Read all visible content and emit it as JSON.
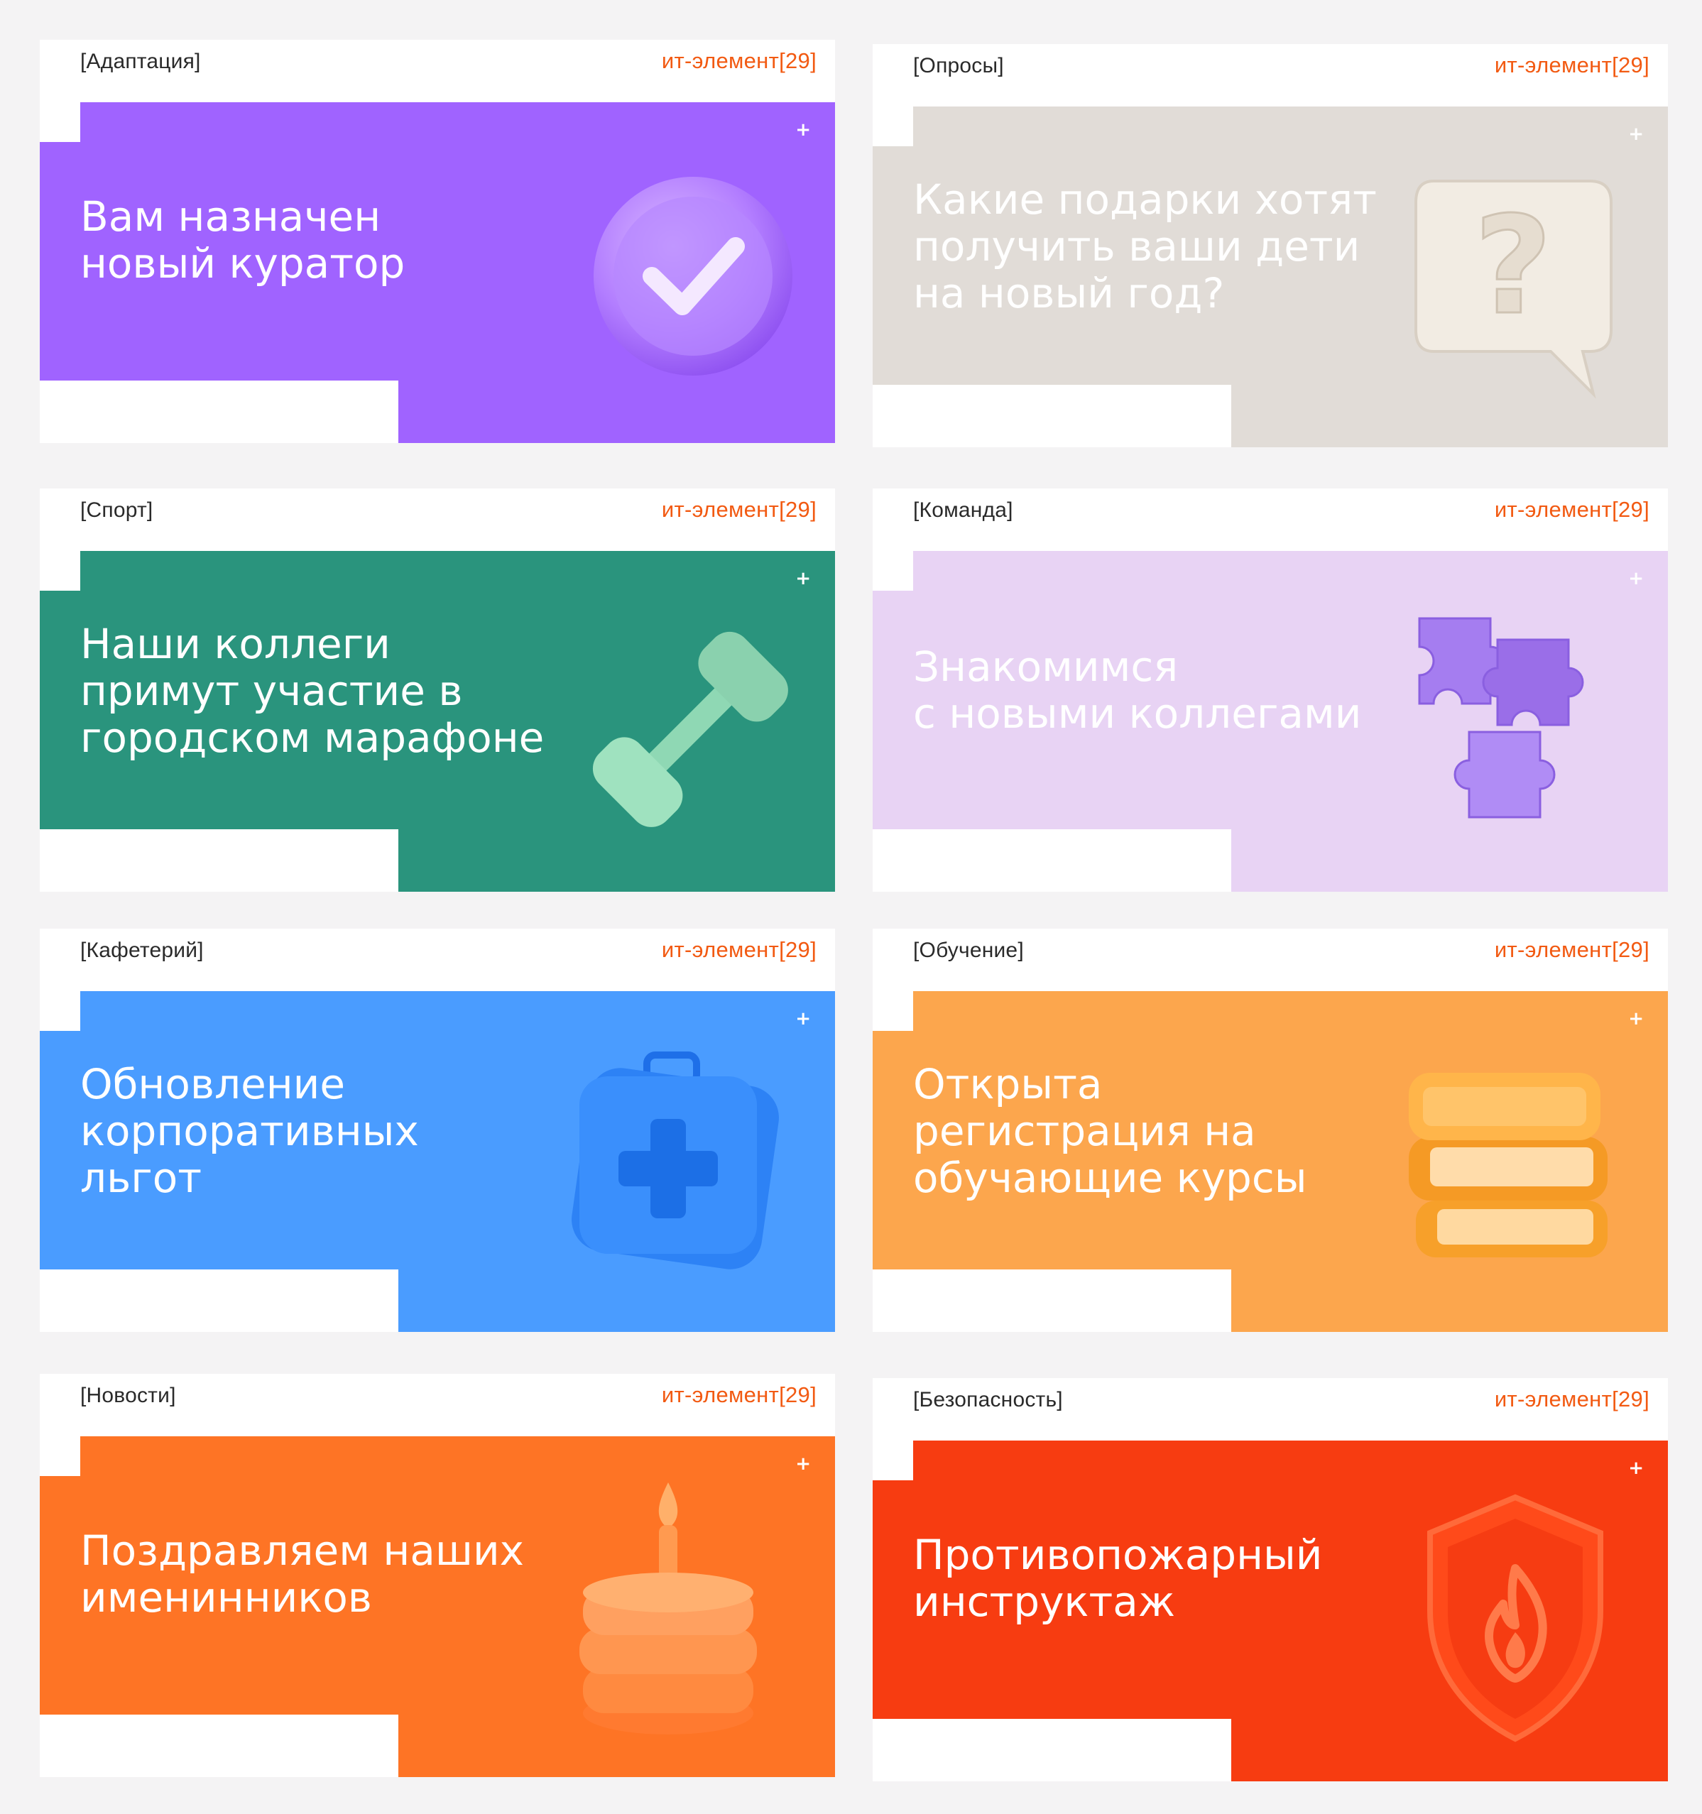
{
  "brand_label": "ит-элемент[29]",
  "plus_symbol": "+",
  "cards": [
    {
      "tag": "[Адаптация]",
      "headline": "Вам назначен\nновый куратор",
      "color": "#a063ff",
      "icon": "checkmark-badge-icon"
    },
    {
      "tag": "[Опросы]",
      "headline": "Какие подарки хотят\nполучить ваши дети\nна новый год?",
      "color": "#e1dcd7",
      "icon": "question-bubble-icon"
    },
    {
      "tag": "[Спорт]",
      "headline": "Наши коллеги\nпримут участие в\nгородском марафоне",
      "color": "#2a947d",
      "icon": "dumbbell-icon"
    },
    {
      "tag": "[Команда]",
      "headline": "Знакомимся\nс новыми коллегами",
      "color": "#e8d3f4",
      "icon": "puzzle-icon"
    },
    {
      "tag": "[Кафетерий]",
      "headline": "Обновление\nкорпоративных\nльгот",
      "color": "#4a9cff",
      "icon": "first-aid-kit-icon"
    },
    {
      "tag": "[Обучение]",
      "headline": "Открыта\nрегистрация на\nобучающие курсы",
      "color": "#fca64d",
      "icon": "books-icon"
    },
    {
      "tag": "[Новости]",
      "headline": "Поздравляем наших\nименинников",
      "color": "#fe7425",
      "icon": "birthday-cake-icon"
    },
    {
      "tag": "[Безопасность]",
      "headline": "Противопожарный\nинструктаж",
      "color": "#f73c11",
      "icon": "fire-shield-icon"
    }
  ]
}
